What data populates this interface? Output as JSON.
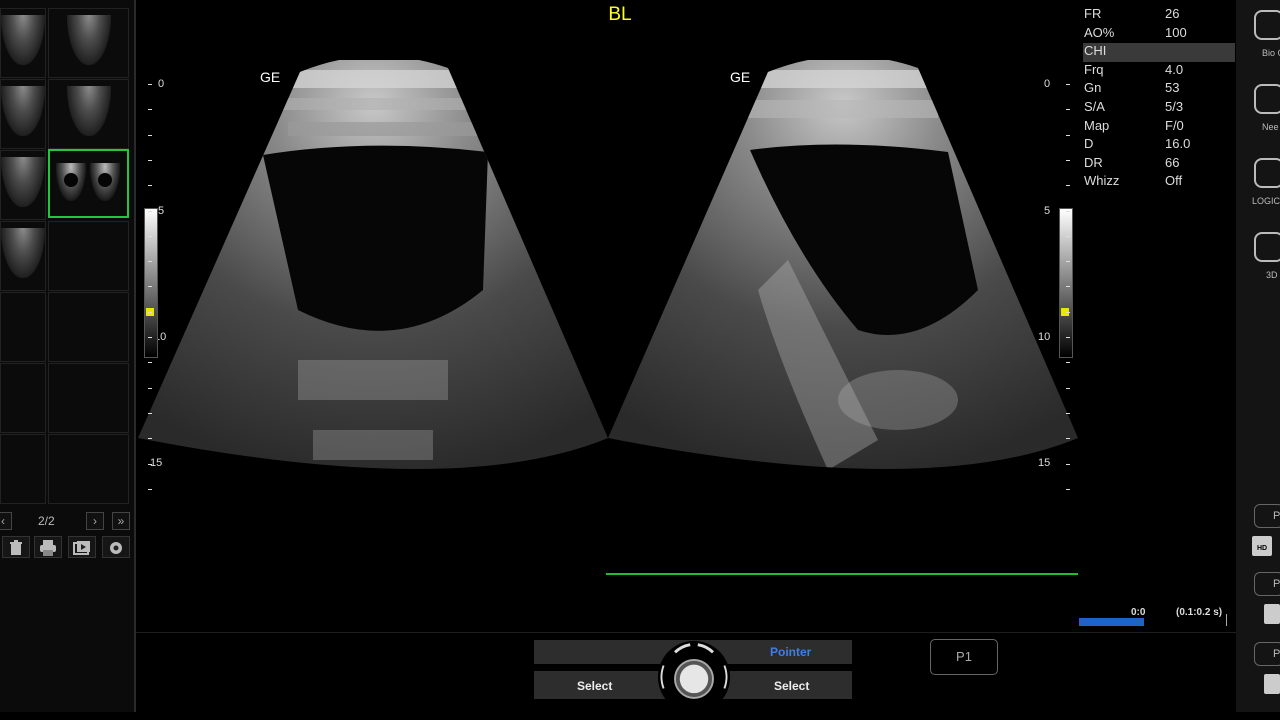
{
  "title": "BL",
  "left_panel": {
    "pager_label": "2/2",
    "prev_icon": "‹",
    "next_icon": "›",
    "last_icon": "»",
    "tools": [
      "trash-icon",
      "print-icon",
      "export-icon",
      "settings-icon"
    ]
  },
  "image": {
    "left_logo": "GE",
    "right_logo": "GE",
    "depth_labels_left": [
      "0",
      "5",
      "10",
      "15"
    ],
    "depth_labels_right": [
      "0",
      "5",
      "10",
      "15"
    ]
  },
  "params": [
    {
      "key": "FR",
      "value": "26"
    },
    {
      "key": "AO%",
      "value": "100"
    },
    {
      "key": "CHI",
      "value": "",
      "highlight": true
    },
    {
      "key": "Frq",
      "value": "4.0"
    },
    {
      "key": "Gn",
      "value": "53"
    },
    {
      "key": "S/A",
      "value": "5/3"
    },
    {
      "key": "Map",
      "value": "F/0"
    },
    {
      "key": "D",
      "value": "16.0"
    },
    {
      "key": "DR",
      "value": "66"
    },
    {
      "key": "Whizz",
      "value": "Off"
    }
  ],
  "right_strip": {
    "labels": [
      "Bio Guid",
      "Nee",
      "LOGIC",
      "3D"
    ],
    "small_buttons": [
      "P",
      "P",
      "P"
    ],
    "hd_label": "HD"
  },
  "cine": {
    "position": "0:0",
    "range": "(0.1:0.2 s)"
  },
  "bottom": {
    "pointer": "Pointer",
    "select_left": "Select",
    "select_right": "Select",
    "p1": "P1"
  },
  "colors": {
    "title": "#ffff1e",
    "selection": "#23c83a",
    "pointer": "#3f7fe0",
    "cine_bar": "#1f62c9",
    "timeline": "#1fbf2a"
  }
}
